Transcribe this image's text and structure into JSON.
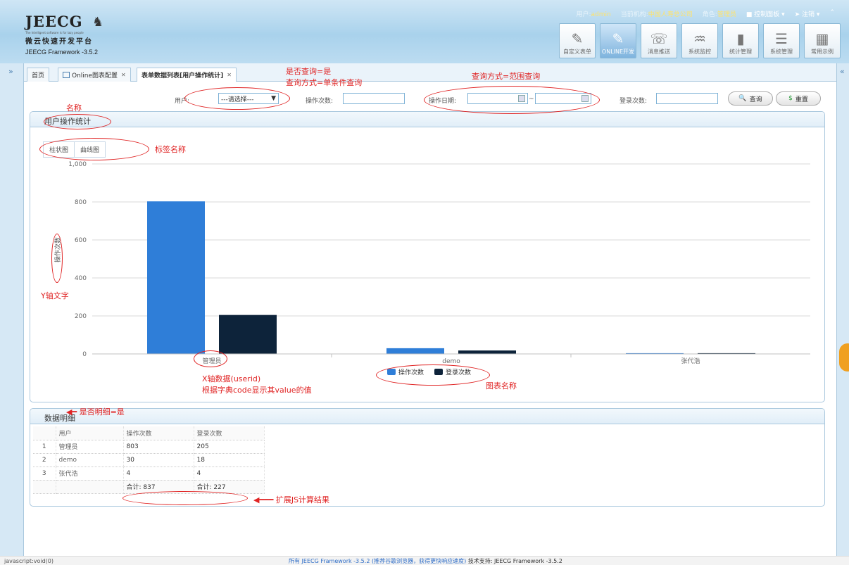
{
  "header": {
    "logo_title": "JEECG",
    "logo_small": "The Intelligent software is for lazy people",
    "logo_sub": "微云快速开发平台",
    "logo_version": "JEECG Framework -3.5.2",
    "user_label": "用户:",
    "user_value": "admin",
    "org_label": "当前机构:",
    "org_value": "中国人寿总公司",
    "role_label": "角色:",
    "role_value": "管理员",
    "control_panel": "控制面板",
    "logout": "注销",
    "icons": [
      {
        "label": "自定义表单",
        "icon": "edit-icon",
        "glyph": "✎"
      },
      {
        "label": "ONLINE开发",
        "icon": "online-dev-icon",
        "glyph": "✎"
      },
      {
        "label": "消息推送",
        "icon": "message-icon",
        "glyph": "☏"
      },
      {
        "label": "系统监控",
        "icon": "monitor-icon",
        "glyph": "♒"
      },
      {
        "label": "统计管理",
        "icon": "stats-icon",
        "glyph": "▮"
      },
      {
        "label": "系统管理",
        "icon": "settings-icon",
        "glyph": "☰"
      },
      {
        "label": "常用示例",
        "icon": "grid-icon",
        "glyph": "▦"
      }
    ]
  },
  "tabs": [
    {
      "label": "首页"
    },
    {
      "label": "Online图表配置"
    },
    {
      "label": "表单数据列表[用户操作统计]"
    }
  ],
  "query": {
    "user_label": "用户:",
    "user_select": "---请选择---",
    "op_count_label": "操作次数:",
    "op_date_label": "操作日期:",
    "range_sep": "~",
    "login_count_label": "登录次数:",
    "search_button": "查询",
    "reset_button": "重置"
  },
  "chart_panel": {
    "title": "用户操作统计",
    "chart_tabs": [
      "柱状图",
      "曲线图"
    ]
  },
  "chart_data": {
    "type": "bar",
    "categories": [
      "管理员",
      "demo",
      "张代浩"
    ],
    "series": [
      {
        "name": "操作次数",
        "values": [
          803,
          30,
          4
        ],
        "color": "#2f7ed8"
      },
      {
        "name": "登录次数",
        "values": [
          205,
          18,
          4
        ],
        "color": "#0d233a"
      }
    ],
    "ylabel": "操作次数",
    "ylim": [
      0,
      1000
    ],
    "yticks": [
      "0",
      "200",
      "400",
      "600",
      "800",
      "1,000"
    ],
    "legend": "bottom-center",
    "grid": true
  },
  "detail_panel": {
    "title": "数据明细",
    "columns": [
      "用户",
      "操作次数",
      "登录次数"
    ],
    "rows": [
      {
        "n": "1",
        "user": "管理员",
        "op": "803",
        "login": "205"
      },
      {
        "n": "2",
        "user": "demo",
        "op": "30",
        "login": "18"
      },
      {
        "n": "3",
        "user": "张代浩",
        "op": "4",
        "login": "4"
      }
    ],
    "total_op": "合计: 837",
    "total_login": "合计: 227"
  },
  "annotations": {
    "is_query": "是否查询=是",
    "query_mode_single": "查询方式=单条件查询",
    "query_mode_range": "查询方式=范围查询",
    "name": "名称",
    "tab_name": "标签名称",
    "y_axis_text": "Y轴文字",
    "x_axis_data": "X轴数据(userid)",
    "x_axis_dict": "根据字典code显示其value的值",
    "chart_name": "图表名称",
    "is_detail": "是否明细=是",
    "js_result": "扩展JS计算结果"
  },
  "status": {
    "left": "javascript:void(0)",
    "copyright_1": "所有 JEECG Framework -3.5.2",
    "copyright_2": "(推荐谷歌浏览器，获得更快响应速度)",
    "copyright_3": "技术支持: JEECG Framework -3.5.2"
  }
}
